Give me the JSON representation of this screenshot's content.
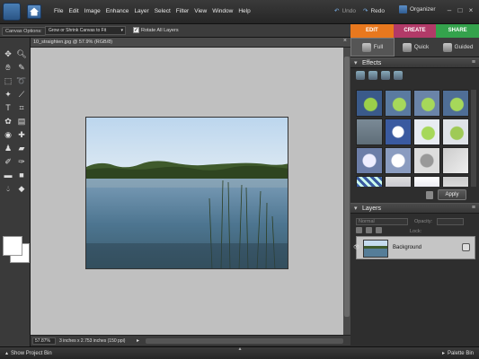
{
  "menubar": {
    "menus": [
      "File",
      "Edit",
      "Image",
      "Enhance",
      "Layer",
      "Select",
      "Filter",
      "View",
      "Window",
      "Help"
    ],
    "undo_label": "Undo",
    "redo_label": "Redo",
    "organizer_label": "Organizer"
  },
  "optionsbar": {
    "canvas_options_label": "Canvas Options:",
    "grow_select_value": "Grow or Shrink Canvas to Fit",
    "rotate_all_label": "Rotate All Layers",
    "rotate_all_checked": true
  },
  "mode_tabs": {
    "edit": "EDIT",
    "create": "CREATE",
    "share": "SHARE",
    "active": "edit"
  },
  "sub_tabs": {
    "full": "Full",
    "quick": "Quick",
    "guided": "Guided",
    "active": "full"
  },
  "document": {
    "title": "10_straighten.jpg @ 57.9% (RGB/8)",
    "zoom": "57.87%",
    "size_info": "3 inches x 2.753 inches (150 ppi)"
  },
  "effects_panel": {
    "title": "Effects",
    "apply_label": "Apply"
  },
  "layers_panel": {
    "title": "Layers",
    "blend_mode": "Normal",
    "opacity_label": "Opacity:",
    "lock_label": "Lock:",
    "layers": [
      {
        "name": "Background",
        "visible": true
      }
    ]
  },
  "bottombar": {
    "project_bin_label": "Show Project Bin",
    "palette_bin_label": "Palette Bin"
  },
  "colors": {
    "edit_tab": "#e8781e",
    "create_tab": "#b23a68",
    "share_tab": "#34a24c",
    "foreground": "#ffffff",
    "background": "#ffffff"
  }
}
